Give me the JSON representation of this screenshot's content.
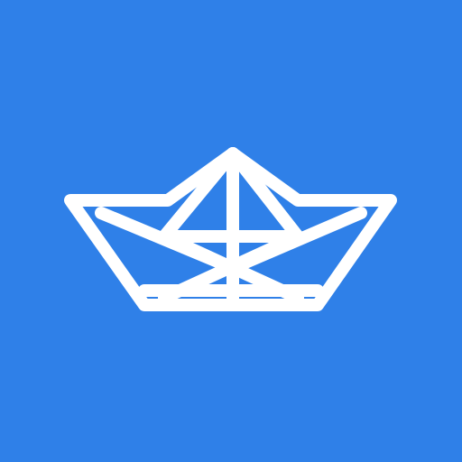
{
  "app_icon": {
    "icon": "paper-boat-icon",
    "colors": {
      "background": "#2F80E8",
      "stroke": "#FFFFFF"
    }
  }
}
